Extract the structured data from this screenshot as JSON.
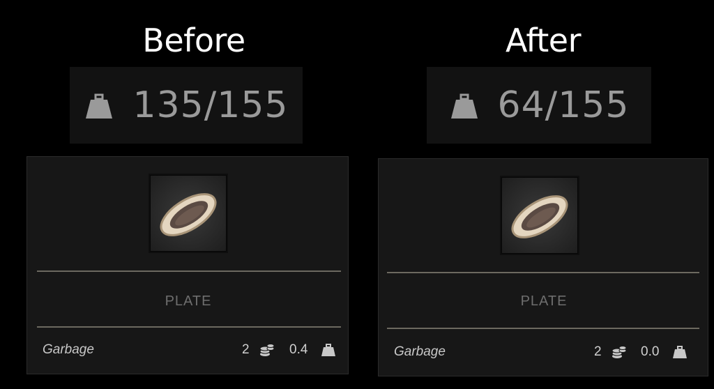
{
  "before": {
    "heading": "Before",
    "weight": "135/155",
    "item_name": "PLATE",
    "category": "Garbage",
    "value": "2",
    "item_weight": "0.4"
  },
  "after": {
    "heading": "After",
    "weight": "64/155",
    "item_name": "PLATE",
    "category": "Garbage",
    "value": "2",
    "item_weight": "0.0"
  },
  "icons": {
    "weight": "weight-icon",
    "coins": "coins-icon",
    "item": "plate-icon"
  },
  "colors": {
    "background": "#000000",
    "panel": "#171717",
    "weight_text": "#9a9a9a",
    "divider": "#8a8579"
  }
}
